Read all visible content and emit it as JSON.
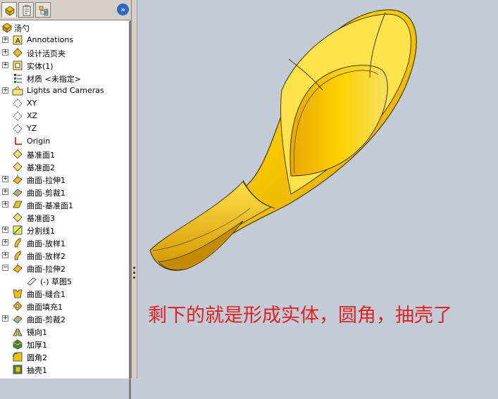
{
  "tabs": [
    {
      "name": "featuremanager-tab-icon"
    },
    {
      "name": "propertymanager-tab-icon"
    },
    {
      "name": "configurationmanager-tab-icon"
    }
  ],
  "collapse_glyph": "»",
  "tree": {
    "root": {
      "label": "汤勺",
      "icon": "part-icon"
    },
    "items": [
      {
        "label": "Annotations",
        "icon": "annotations-icon",
        "expandable": true,
        "expanded": false
      },
      {
        "label": "设计活页夹",
        "icon": "design-binder-icon",
        "expandable": true,
        "expanded": false
      },
      {
        "label": "实体(1)",
        "icon": "solid-bodies-icon",
        "expandable": true,
        "expanded": false
      },
      {
        "label": "材质 <未指定>",
        "icon": "material-icon",
        "expandable": false
      },
      {
        "label": "Lights and Cameras",
        "icon": "lights-icon",
        "expandable": true,
        "expanded": false
      },
      {
        "label": "XY",
        "icon": "plane-icon",
        "expandable": false
      },
      {
        "label": "XZ",
        "icon": "plane-icon",
        "expandable": false
      },
      {
        "label": "YZ",
        "icon": "plane-icon",
        "expandable": false
      },
      {
        "label": "Origin",
        "icon": "origin-icon",
        "expandable": false
      },
      {
        "label": "基准面1",
        "icon": "reference-plane-icon",
        "expandable": false
      },
      {
        "label": "基准面2",
        "icon": "reference-plane-icon",
        "expandable": false
      },
      {
        "label": "曲面-拉伸1",
        "icon": "surface-extrude-icon",
        "expandable": true,
        "expanded": false
      },
      {
        "label": "曲面-剪裁1",
        "icon": "surface-trim-icon",
        "expandable": true,
        "expanded": false
      },
      {
        "label": "曲面-基准面1",
        "icon": "planar-surface-icon",
        "expandable": true,
        "expanded": false
      },
      {
        "label": "基准面3",
        "icon": "reference-plane-icon",
        "expandable": false
      },
      {
        "label": "分割线1",
        "icon": "split-line-icon",
        "expandable": true,
        "expanded": false
      },
      {
        "label": "曲面-放样1",
        "icon": "surface-loft-icon",
        "expandable": true,
        "expanded": false
      },
      {
        "label": "曲面-放样2",
        "icon": "surface-loft-icon",
        "expandable": true,
        "expanded": false
      },
      {
        "label": "曲面-拉伸2",
        "icon": "surface-extrude-icon",
        "expandable": true,
        "expanded": true
      },
      {
        "label": "(-) 草图5",
        "icon": "sketch-icon",
        "expandable": false,
        "child": true
      },
      {
        "label": "曲面-缝合1",
        "icon": "surface-knit-icon",
        "expandable": false
      },
      {
        "label": "曲面填充1",
        "icon": "filled-surface-icon",
        "expandable": false
      },
      {
        "label": "曲面-剪裁2",
        "icon": "surface-trim-icon",
        "expandable": true,
        "expanded": false
      },
      {
        "label": "镜向1",
        "icon": "mirror-icon",
        "expandable": false
      },
      {
        "label": "加厚1",
        "icon": "thicken-icon",
        "expandable": false
      },
      {
        "label": "圆角2",
        "icon": "fillet-icon",
        "expandable": false
      },
      {
        "label": "抽壳1",
        "icon": "shell-icon",
        "expandable": false
      }
    ]
  },
  "viewport": {
    "model_color": "#f5c400",
    "background": "#c3ccd6",
    "caption": "剩下的就是形成实体，圆角，抽壳了",
    "caption_color": "#e22222"
  }
}
